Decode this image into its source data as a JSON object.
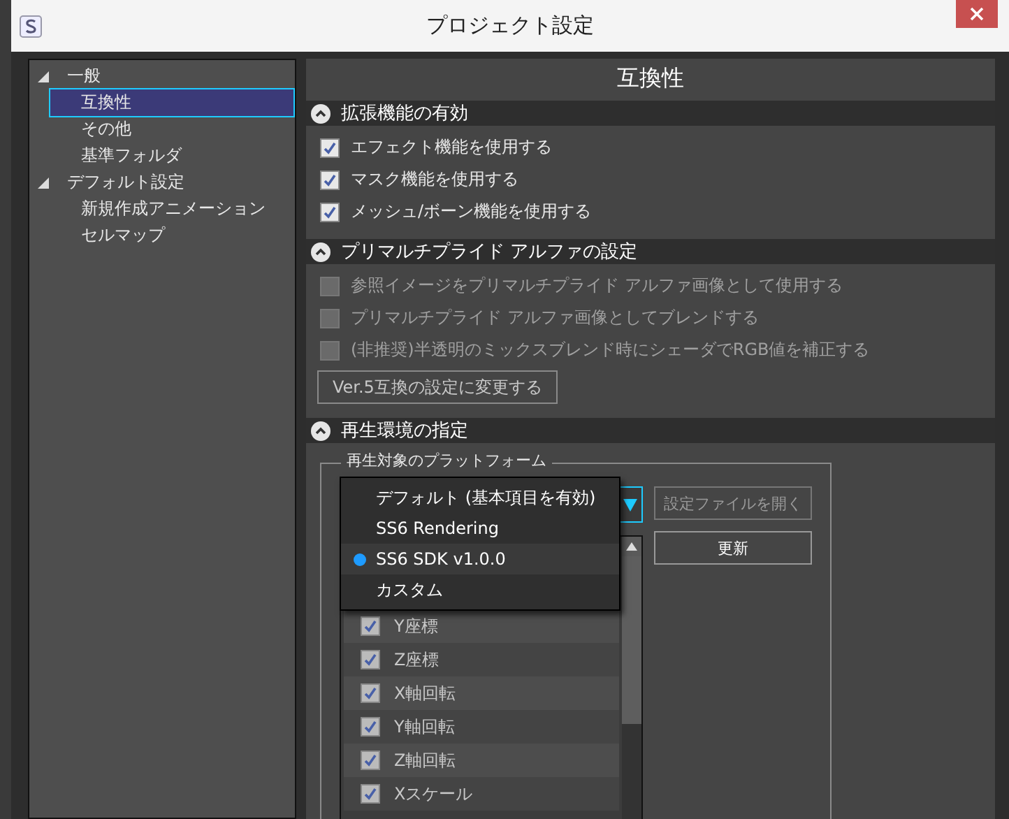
{
  "window": {
    "title": "プロジェクト設定"
  },
  "tree": [
    {
      "label": "一般",
      "expanded": true,
      "selected": false,
      "children": [
        {
          "label": "互換性",
          "selected": true
        },
        {
          "label": "その他",
          "selected": false
        },
        {
          "label": "基準フォルダ",
          "selected": false
        }
      ]
    },
    {
      "label": "デフォルト設定",
      "expanded": true,
      "selected": false,
      "children": [
        {
          "label": "新規作成アニメーション",
          "selected": false
        },
        {
          "label": "セルマップ",
          "selected": false
        }
      ]
    }
  ],
  "panel": {
    "title": "互換性",
    "sections": [
      {
        "title": "拡張機能の有効",
        "expanded": true,
        "items": [
          {
            "kind": "checkbox",
            "label": "エフェクト機能を使用する",
            "checked": true,
            "disabled": false
          },
          {
            "kind": "checkbox",
            "label": "マスク機能を使用する",
            "checked": true,
            "disabled": false
          },
          {
            "kind": "checkbox",
            "label": "メッシュ/ボーン機能を使用する",
            "checked": true,
            "disabled": false
          }
        ]
      },
      {
        "title": "プリマルチプライド アルファの設定",
        "expanded": true,
        "items": [
          {
            "kind": "checkbox",
            "label": "参照イメージをプリマルチプライド アルファ画像として使用する",
            "checked": false,
            "disabled": true
          },
          {
            "kind": "checkbox",
            "label": "プリマルチプライド アルファ画像としてブレンドする",
            "checked": false,
            "disabled": true
          },
          {
            "kind": "checkbox",
            "label": "(非推奨)半透明のミックスブレンド時にシェーダでRGB値を補正する",
            "checked": false,
            "disabled": true
          },
          {
            "kind": "button",
            "label": "Ver.5互換の設定に変更する"
          }
        ]
      },
      {
        "title": "再生環境の指定",
        "expanded": true,
        "items": [
          {
            "kind": "group",
            "legend": "再生対象のプラットフォーム",
            "dropdown": {
              "expanded": true,
              "options": [
                {
                  "label": "デフォルト (基本項目を有効)",
                  "selected": false
                },
                {
                  "label": "SS6 Rendering",
                  "selected": false
                },
                {
                  "label": "SS6 SDK v1.0.0",
                  "selected": true
                },
                {
                  "label": "カスタム",
                  "selected": false
                }
              ]
            },
            "buttons": [
              {
                "label": "設定ファイルを開く",
                "disabled": true
              },
              {
                "label": "更新",
                "disabled": false
              }
            ],
            "list": [
              {
                "label": "Y座標",
                "checked": true
              },
              {
                "label": "Z座標",
                "checked": true
              },
              {
                "label": "X軸回転",
                "checked": true
              },
              {
                "label": "Y軸回転",
                "checked": true
              },
              {
                "label": "Z軸回転",
                "checked": true
              },
              {
                "label": "Xスケール",
                "checked": true
              }
            ]
          }
        ]
      }
    ]
  }
}
